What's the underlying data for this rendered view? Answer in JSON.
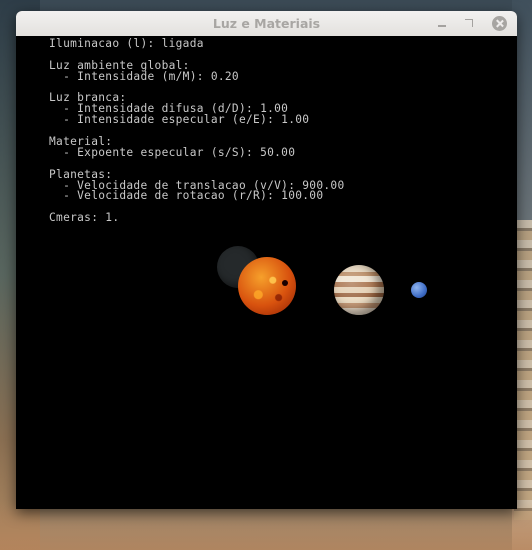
{
  "window": {
    "title": "Luz e Materiais",
    "controls": {
      "minimize": "minimize-icon",
      "maximize": "maximize-icon",
      "close": "close-icon"
    }
  },
  "hud": {
    "lines": [
      "Iluminacao (l): ligada",
      "",
      "Luz ambiente global:",
      "  - Intensidade (m/M): 0.20",
      "",
      "Luz branca:",
      "  - Intensidade difusa (d/D): 1.00",
      "  - Intensidade especular (e/E): 1.00",
      "",
      "Material:",
      "  - Expoente especular (s/S): 50.00",
      "",
      "Planetas:",
      "  - Velocidade de translacao (v/V): 900.00",
      "  - Velocidade de rotacao (r/R): 100.00",
      "",
      "Cmeras: 1."
    ]
  },
  "scene": {
    "bodies": [
      "moon",
      "sun",
      "jupiter",
      "neptune"
    ],
    "colors": {
      "background": "#000000",
      "text": "#c8c8c8"
    }
  }
}
